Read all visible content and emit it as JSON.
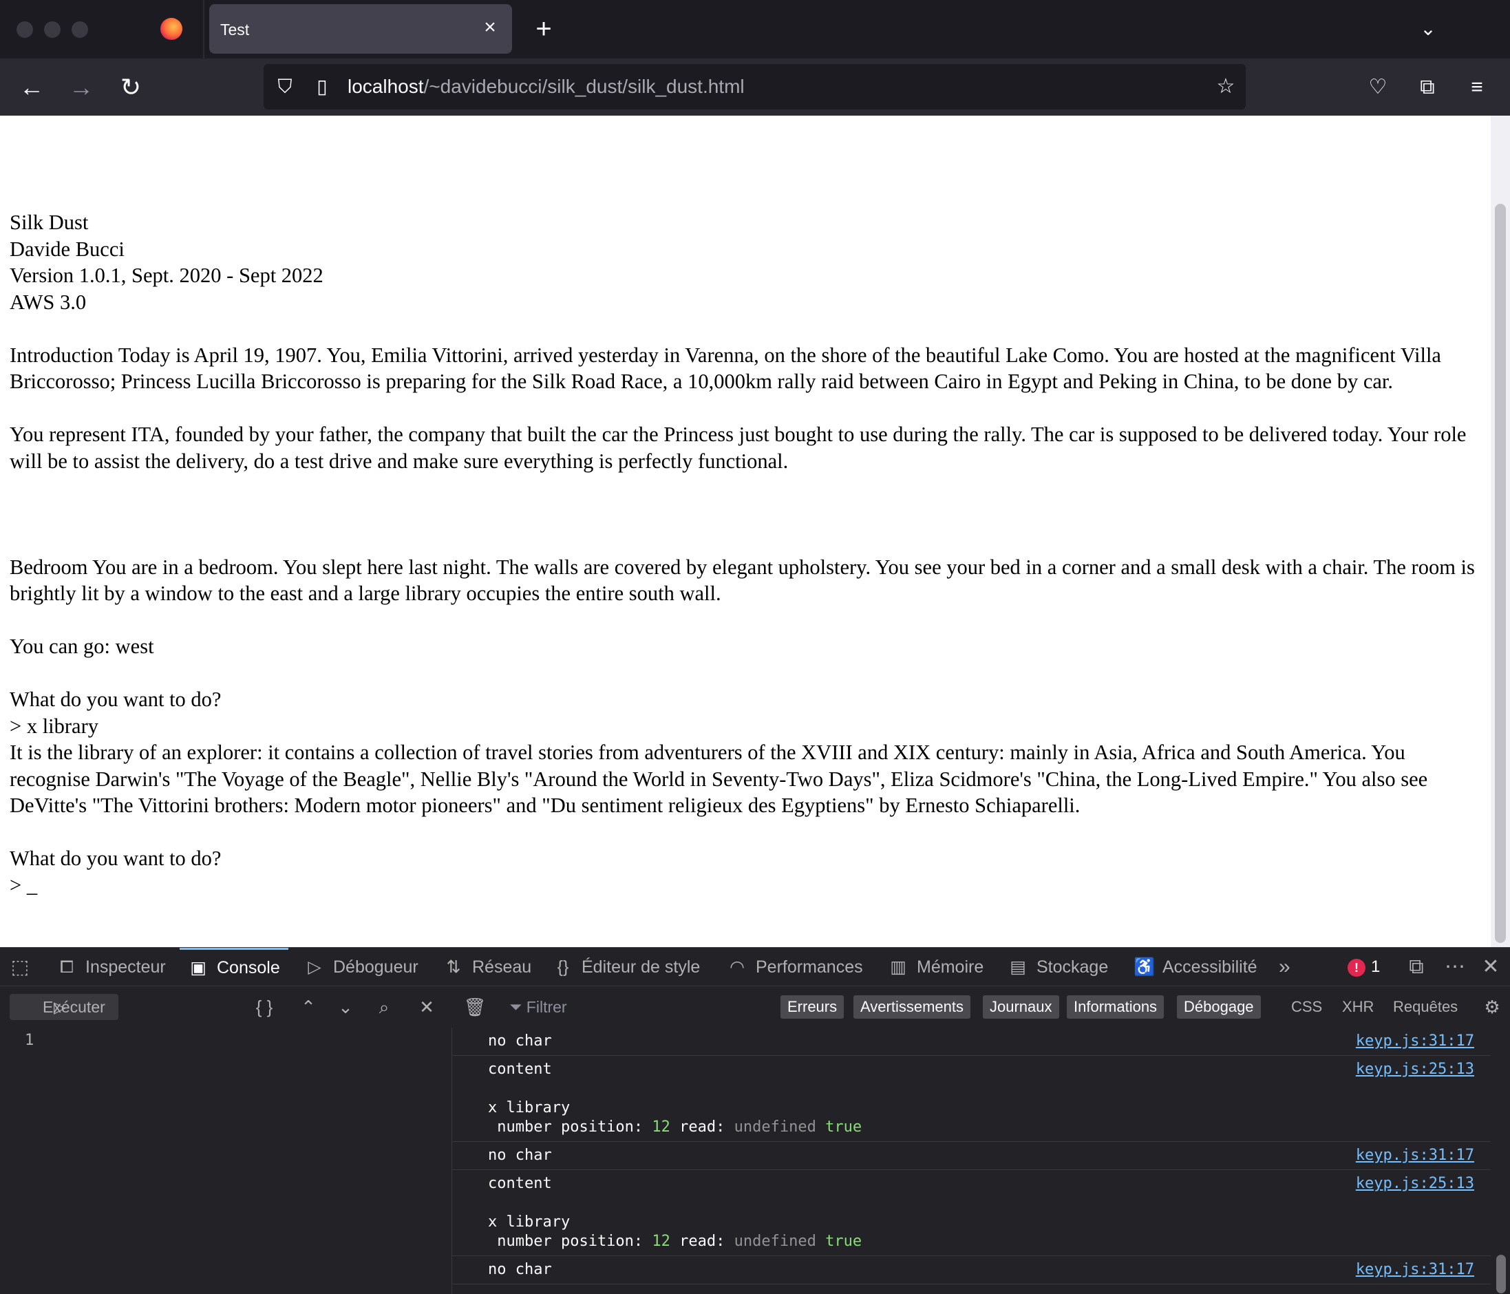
{
  "tab": {
    "title": "Test"
  },
  "url": {
    "host": "localhost",
    "path": "/~davidebucci/silk_dust/silk_dust.html"
  },
  "page": {
    "header": [
      "Silk Dust",
      "Davide Bucci",
      "Version 1.0.1, Sept. 2020 - Sept 2022",
      "AWS 3.0"
    ],
    "intro1": "Introduction Today is April 19, 1907. You, Emilia Vittorini, arrived yesterday in Varenna, on the shore of the beautiful Lake Como. You are hosted at the magnificent Villa Briccorosso; Princess Lucilla Briccorosso is preparing for the Silk Road Race, a 10,000km rally raid between Cairo in Egypt and Peking in China, to be done by car.",
    "intro2": "You represent ITA, founded by your father, the company that built the car the Princess just bought to use during the rally. The car is supposed to be delivered today. Your role will be to assist the delivery, do a test drive and make sure everything is perfectly functional.",
    "bedroom": "Bedroom You are in a bedroom. You slept here last night. The walls are covered by elegant upholstery. You see your bed in a corner and a small desk with a chair. The room is brightly lit by a window to the east and a large library occupies the entire south wall.",
    "exits": "You can go: west",
    "prompt1": "What do you want to do?",
    "command1": "> x library",
    "library": "It is the library of an explorer: it contains a collection of travel stories from adventurers of the XVIII and XIX century: mainly in Asia, Africa and South America. You recognise Darwin's \"The Voyage of the Beagle\", Nellie Bly's \"Around the World in Seventy-Two Days\", Eliza Scidmore's \"China, the Long-Lived Empire.\" You also see DeVitte's \"The Vittorini brothers: Modern motor pioneers\" and \"Du sentiment religieux des Egyptiens\" by Ernesto Schiaparelli.",
    "prompt2": "What do you want to do?",
    "cursor": "> _"
  },
  "devtools": {
    "tabs": [
      "Inspecteur",
      "Console",
      "Débogueur",
      "Réseau",
      "Éditeur de style",
      "Performances",
      "Mémoire",
      "Stockage",
      "Accessibilité"
    ],
    "error_count": "1",
    "run_label": "Exécuter",
    "filter_placeholder": "Filtrer",
    "levels": [
      "Erreurs",
      "Avertissements",
      "Journaux",
      "Informations",
      "Débogage"
    ],
    "types": [
      "CSS",
      "XHR",
      "Requêtes"
    ],
    "editor_line": "1",
    "messages": [
      {
        "lines": [
          "no char"
        ],
        "source": "keyp.js:31:17"
      },
      {
        "lines": [
          "content",
          "",
          "x library"
        ],
        "detail": {
          "label": " number position:",
          "pos": "12",
          "read": "read:",
          "undef": "undefined",
          "bool": "true"
        },
        "source": "keyp.js:25:13"
      },
      {
        "lines": [
          "no char"
        ],
        "source": "keyp.js:31:17"
      },
      {
        "lines": [
          "content",
          "",
          "x library"
        ],
        "detail": {
          "label": " number position:",
          "pos": "12",
          "read": "read:",
          "undef": "undefined",
          "bool": "true"
        },
        "source": "keyp.js:25:13"
      },
      {
        "lines": [
          "no char"
        ],
        "source": "keyp.js:31:17"
      }
    ]
  },
  "colors": {
    "accent": "#75bfff",
    "number": "#86de74",
    "error": "#e22850"
  }
}
